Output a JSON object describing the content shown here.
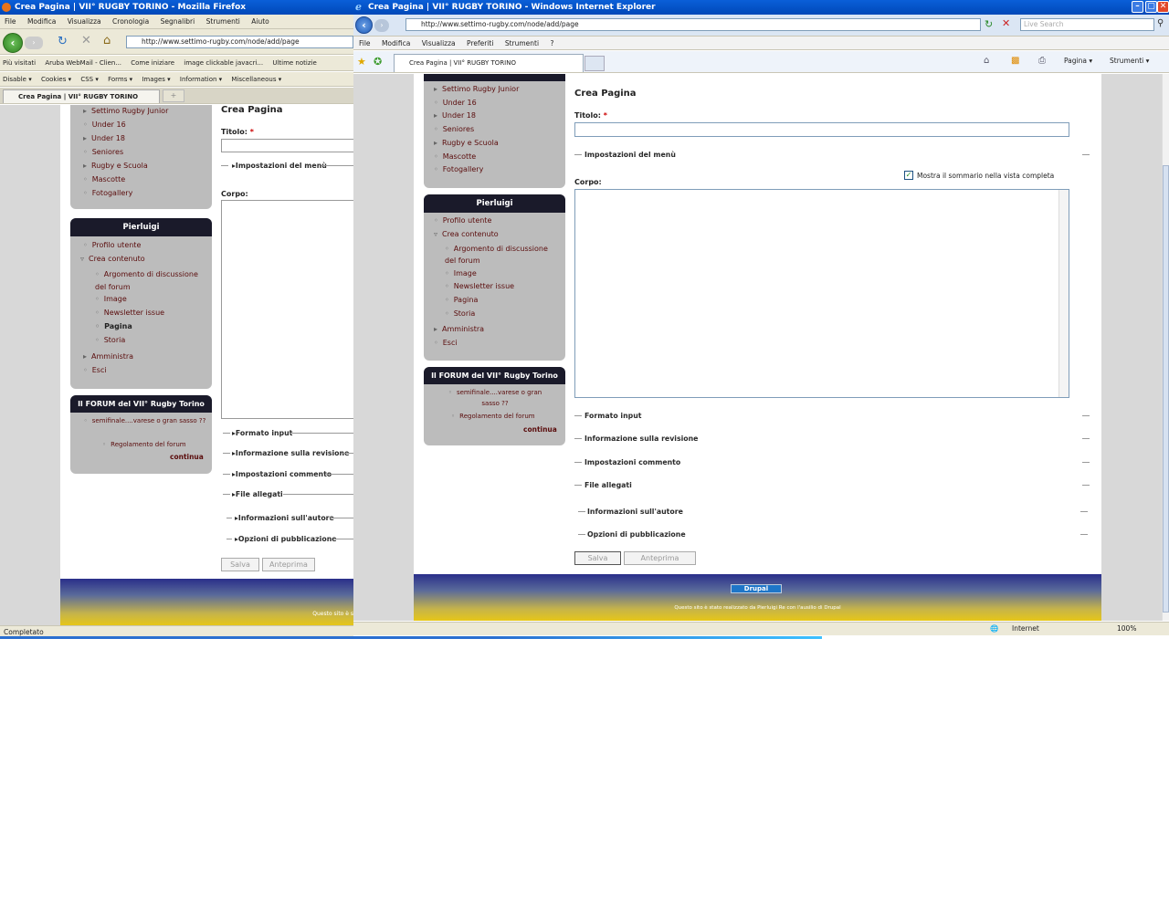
{
  "firefox": {
    "title": "Crea Pagina | VII° RUGBY TORINO - Mozilla Firefox",
    "menu": [
      "File",
      "Modifica",
      "Visualizza",
      "Cronologia",
      "Segnalibri",
      "Strumenti",
      "Aiuto"
    ],
    "url": "http://www.settimo-rugby.com/node/add/page",
    "bookmarks": [
      "Più visitati",
      "Aruba WebMail - Clien...",
      "Come iniziare",
      "image clickable javacri...",
      "Ultime notizie"
    ],
    "devbar": [
      "Disable ▾",
      "Cookies ▾",
      "CSS ▾",
      "Forms ▾",
      "Images ▾",
      "Information ▾",
      "Miscellaneous ▾"
    ],
    "tab": "Crea Pagina | VII° RUGBY TORINO",
    "tab_add": "+",
    "status": "Completato",
    "footer_text": "Questo sito è s"
  },
  "ie": {
    "title": "Crea Pagina | VII° RUGBY TORINO - Windows Internet Explorer",
    "url": "http://www.settimo-rugby.com/node/add/page",
    "search_placeholder": "Live Search",
    "menu": [
      "File",
      "Modifica",
      "Visualizza",
      "Preferiti",
      "Strumenti",
      "?"
    ],
    "tab": "Crea Pagina | VII° RUGBY TORINO",
    "cmd_page": "Pagina ▾",
    "cmd_tools": "Strumenti ▾",
    "status_zone": "Internet",
    "zoom": "100%",
    "footer_logo": "Drupal",
    "footer_text": "Questo sito è stato realizzato da Pierluigi Re con l'ausilio di Drupal"
  },
  "nav": {
    "items": [
      "Settimo Rugby Junior",
      "Under 16",
      "Under 18",
      "Seniores",
      "Rugby e Scuola",
      "Mascotte",
      "Fotogallery"
    ]
  },
  "user": {
    "title": "Pierluigi",
    "profile": "Profilo utente",
    "create": "Crea contenuto",
    "create_items": [
      "Argomento di discussione del forum",
      "Image",
      "Newsletter issue",
      "Pagina",
      "Storia"
    ],
    "admin": "Amministra",
    "logout": "Esci"
  },
  "forum": {
    "title": "Il FORUM del VII° Rugby Torino",
    "items": [
      "semifinale....varese o gran sasso ??",
      "Regolamento del forum"
    ],
    "more": "continua"
  },
  "form": {
    "heading": "Crea Pagina",
    "title_label": "Titolo:",
    "required": "*",
    "menu_settings": "Impostazioni del menù",
    "summary_checkbox": "Mostra il sommario nella vista completa",
    "body_label": "Corpo:",
    "sections": [
      "Formato input",
      "Informazione sulla revisione",
      "Impostazioni commento",
      "File allegati"
    ],
    "sections2": [
      "Informazioni sull'autore",
      "Opzioni di pubblicazione"
    ],
    "save": "Salva",
    "preview": "Anteprima"
  }
}
